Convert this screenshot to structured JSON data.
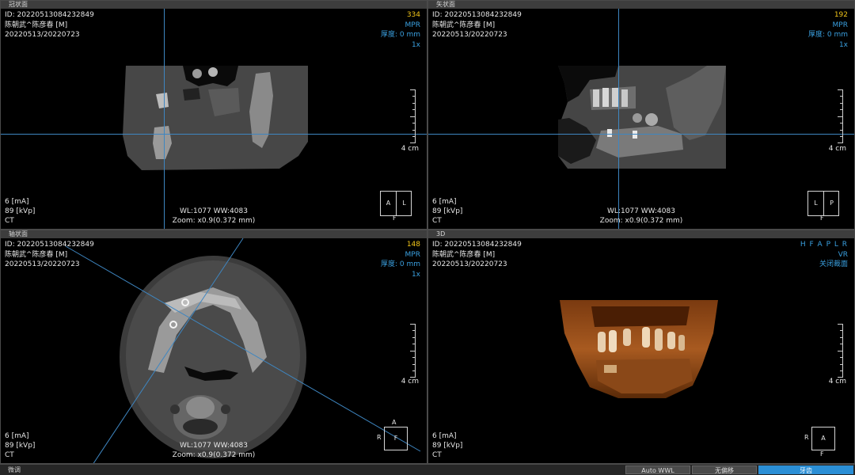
{
  "panes": {
    "coronal": {
      "title": "冠状面",
      "id_line": "ID: 202205130842328​49",
      "patient": "陈朝武^陈彦春  [M]",
      "dates": "20220513/20220723",
      "slice": "334",
      "mode": "MPR",
      "thickness": "厚度: 0 mm",
      "zoom_factor": "1x",
      "ma": "6 [mA]",
      "kvp": "89 [kVp]",
      "modality": "CT",
      "wl": "WL:1077 WW:4083",
      "zoom": "Zoom: x0.9(0.372 mm)",
      "scale_label": "4 cm",
      "orient": [
        "A",
        "L"
      ],
      "orient_bottom": "F"
    },
    "sagittal": {
      "title": "矢状面",
      "id_line": "ID: 20220513084232849",
      "patient": "陈朝武^陈彦春  [M]",
      "dates": "20220513/20220723",
      "slice": "192",
      "mode": "MPR",
      "thickness": "厚度: 0 mm",
      "zoom_factor": "1x",
      "ma": "6 [mA]",
      "kvp": "89 [kVp]",
      "modality": "CT",
      "wl": "WL:1077 WW:4083",
      "zoom": "Zoom: x0.9(0.372 mm)",
      "scale_label": "4 cm",
      "orient": [
        "L",
        "P"
      ],
      "orient_bottom": "F"
    },
    "axial": {
      "title": "轴状面",
      "id_line": "ID: 20220513084232849",
      "patient": "陈朝武^陈彦春  [M]",
      "dates": "20220513/20220723",
      "slice": "148",
      "mode": "MPR",
      "thickness": "厚度: 0 mm",
      "zoom_factor": "1x",
      "ma": "6 [mA]",
      "kvp": "89 [kVp]",
      "modality": "CT",
      "wl": "WL:1077 WW:4083",
      "zoom": "Zoom: x0.9(0.372 mm)",
      "scale_label": "4 cm",
      "orient_top": "A",
      "orient_left": "R",
      "orient_center": "F"
    },
    "threed": {
      "title": "3D",
      "id_line": "ID: 20220513084232849",
      "patient": "陈朝武^陈彦春  [M]",
      "dates": "20220513/20220723",
      "directions": "H F A P L R",
      "mode": "VR",
      "clip": "关闭裁面",
      "ma": "6 [mA]",
      "kvp": "89 [kVp]",
      "modality": "CT",
      "scale_label": "4 cm",
      "orient_left": "R",
      "orient_center": "A",
      "orient_bottom": "F"
    }
  },
  "statusbar": {
    "label": "微调",
    "buttons": [
      "Auto WWL",
      "无偏移",
      "牙齿"
    ],
    "active_index": 2
  },
  "colors": {
    "crosshair": "#3e86c1",
    "slice_number": "#f0c419",
    "mpr_text": "#3aa0e0",
    "active_button": "#2b8fd6"
  }
}
